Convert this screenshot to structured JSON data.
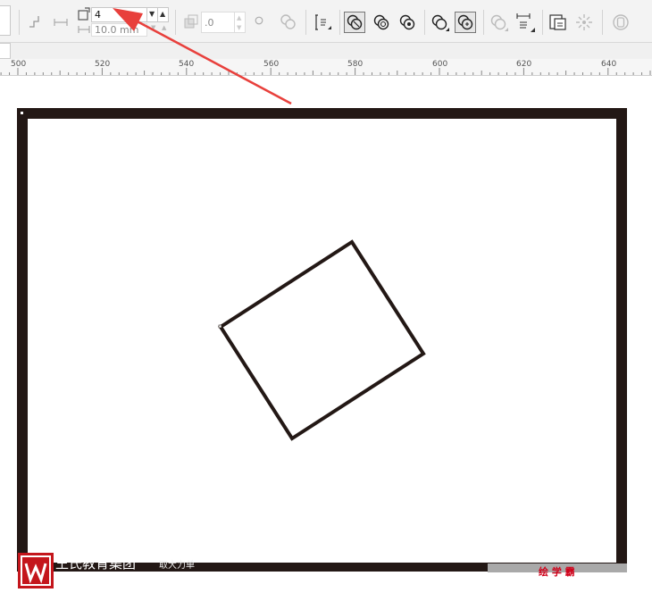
{
  "toolbar": {
    "outline_count_value": "4",
    "outline_offset_value": "10.0 mm",
    "position_value": ".0"
  },
  "ruler": {
    "labels": [
      "500",
      "520",
      "540",
      "560",
      "580",
      "600",
      "620",
      "640"
    ]
  },
  "footer": {
    "brand_text": "王氏教育集团",
    "sub_text": "取大力单",
    "right_text": "绘 学 霸"
  },
  "colors": {
    "frame": "#231815",
    "arrow": "#e8403c",
    "logo": "#c4161c"
  }
}
